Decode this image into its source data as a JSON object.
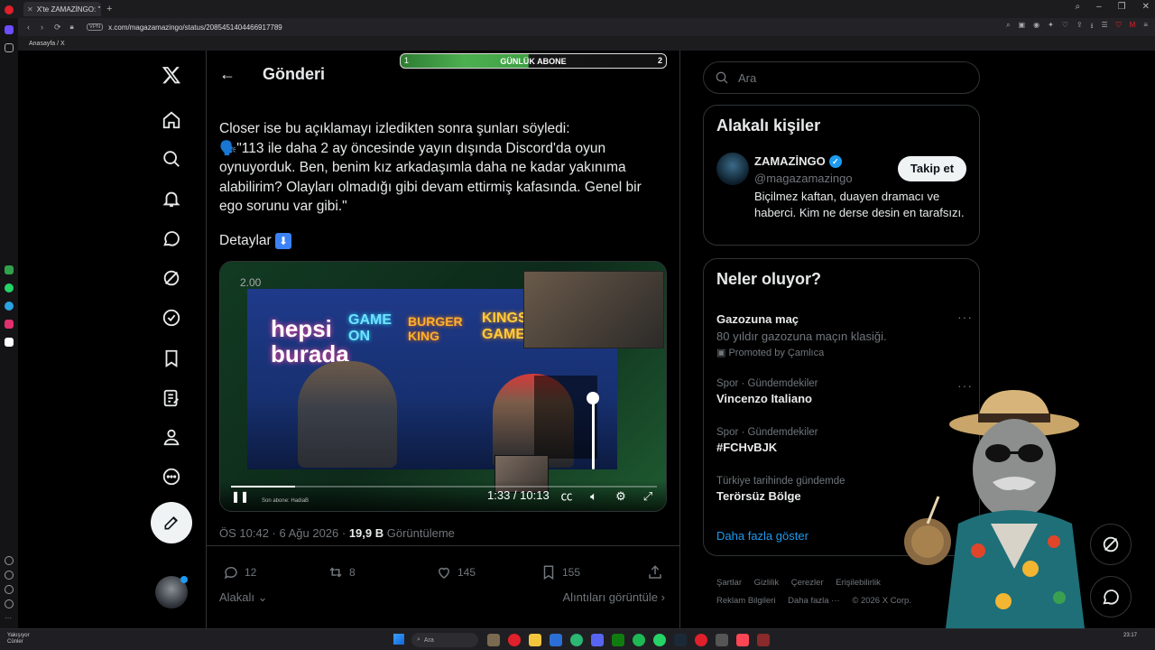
{
  "browser": {
    "tab_title": "X'te ZAMAZİNGO: \"",
    "url": "x.com/magazamazingo/status/2085451404466917789",
    "vpn_label": "VPN",
    "bookmark": "Anasayfa / X"
  },
  "header": {
    "title": "Gönderi",
    "abone_left": "1",
    "abone_label": "GÜNLÜK ABONE",
    "abone_right": "2",
    "abone_progress": 0.48
  },
  "tweet": {
    "lines": [
      "Closer ise bu açıklamayı izledikten sonra şunları söyledi:",
      "🗣️\"113 ile daha 2 ay öncesinde yayın dışında Discord'da oyun oynuyorduk. Ben, benim kız arkadaşımla daha ne kadar yakınıma alabilirim? Olayları olmadığı gibi devam ettirmiş kafasında. Genel bir ego sorunu var gibi.\""
    ],
    "detaylar": "Detaylar",
    "detaylar_emoji": "⬇️",
    "video": {
      "rate": "2.00",
      "time": "1:33 / 10:13",
      "progress": 0.15,
      "son_abone": "Son abone: HadiaB",
      "neon_hepsi": "hepsi burada",
      "neon_gameon": "GAME ON",
      "neon_burger": "BURGER KING",
      "neon_kings": "KINGS GAMES"
    },
    "meta_time": "ÖS 10:42 · 6 Ağu 2026 · ",
    "views": "19,9 B",
    "views_label": " Görüntüleme",
    "replies": "12",
    "reposts": "8",
    "likes": "145",
    "bookmarks": "155",
    "alakali": "Alakalı",
    "alintilar": "Alıntıları görüntüle"
  },
  "right": {
    "search_placeholder": "Ara",
    "related_title": "Alakalı kişiler",
    "person_name": "ZAMAZİNGO",
    "person_handle": "@magazamazingo",
    "person_bio": "Biçilmez kaftan, duayen dramacı ve haberci. Kim ne derse desin en tarafsızı.",
    "follow_label": "Takip et",
    "trends_title": "Neler oluyor?",
    "trends": [
      {
        "context": "",
        "name": "Gazozuna maç",
        "desc": "80 yıldır gazozuna maçın klasiği.",
        "promo": "Promoted by Çamlıca"
      },
      {
        "context": "Spor · Gündemdekiler",
        "name": "Vincenzo Italiano"
      },
      {
        "context": "Spor · Gündemdekiler",
        "name": "#FCHvBJK"
      },
      {
        "context": "Türkiye tarihinde gündemde",
        "name": "Terörsüz Bölge"
      }
    ],
    "show_more": "Daha fazla göster",
    "footer_row1": [
      "Şartlar",
      "Gizlilik",
      "Çerezler",
      "Erişilebilirlik"
    ],
    "footer_row2": [
      "Reklam Bilgileri",
      "Daha fazla ···",
      "© 2026 X Corp."
    ]
  },
  "taskbar": {
    "weather_line1": "Yakışıyor",
    "weather_line2": "Cünler",
    "search": "Ara",
    "clock": "23:17"
  },
  "colors": {
    "accent": "#1d9bf0",
    "bg": "#000000",
    "border": "#2f3336"
  }
}
